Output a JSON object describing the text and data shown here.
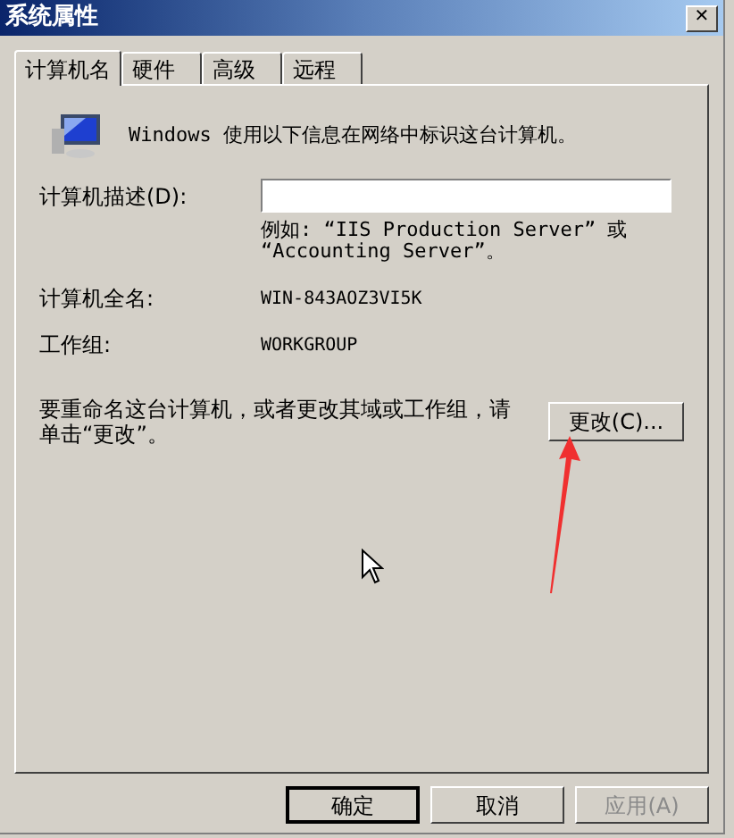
{
  "window": {
    "title": "系统属性",
    "close": "✕"
  },
  "tabs": [
    {
      "label": "计算机名",
      "selected": true
    },
    {
      "label": "硬件",
      "selected": false
    },
    {
      "label": "高级",
      "selected": false
    },
    {
      "label": "远程",
      "selected": false
    }
  ],
  "intro": "Windows 使用以下信息在网络中标识这台计算机。",
  "description": {
    "label": "计算机描述(D):",
    "example_lines": [
      "例如: “IIS Production Server” 或",
      "“Accounting Server”。"
    ]
  },
  "full_name": {
    "label": "计算机全名:",
    "value": "WIN-843AOZ3VI5K"
  },
  "workgroup": {
    "label": "工作组:",
    "value": "WORKGROUP"
  },
  "rename": {
    "text": "要重命名这台计算机，或者更改其域或工作组，请单击“更改”。",
    "button": "更改(C)..."
  },
  "buttons": [
    {
      "label": "确定",
      "default": true,
      "disabled": false
    },
    {
      "label": "取消",
      "default": false,
      "disabled": false
    },
    {
      "label": "应用(A)",
      "default": false,
      "disabled": true
    }
  ]
}
